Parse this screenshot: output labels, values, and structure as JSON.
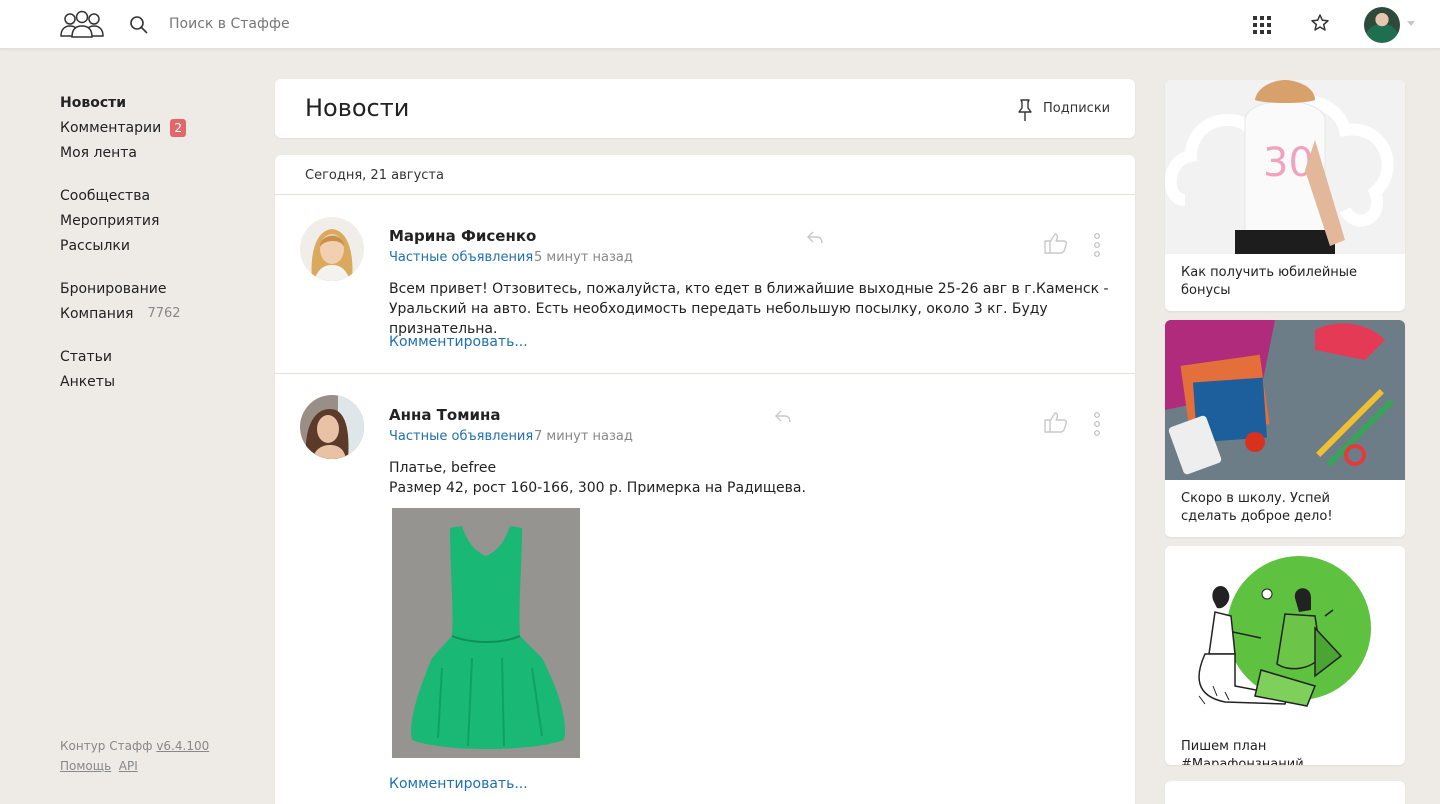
{
  "header": {
    "search_placeholder": "Поиск в Стаффе"
  },
  "nav": {
    "groups": [
      [
        {
          "label": "Новости",
          "active": true
        },
        {
          "label": "Комментарии",
          "badge": "2"
        },
        {
          "label": "Моя лента"
        }
      ],
      [
        {
          "label": "Сообщества"
        },
        {
          "label": "Мероприятия"
        },
        {
          "label": "Рассылки"
        }
      ],
      [
        {
          "label": "Бронирование"
        },
        {
          "label": "Компания",
          "count": "7762"
        }
      ],
      [
        {
          "label": "Статьи"
        },
        {
          "label": "Анкеты"
        }
      ]
    ]
  },
  "footer": {
    "product": "Контур Стафф",
    "version": "v6.4.100",
    "help": "Помощь",
    "api": "API"
  },
  "main": {
    "title": "Новости",
    "subscriptions_label": "Подписки",
    "date_header": "Сегодня, 21 августа",
    "posts": [
      {
        "author": "Марина Фисенко",
        "category": "Частные объявления",
        "time": "5 минут назад",
        "text": "Всем привет! Отзовитесь, пожалуйста, кто едет в ближайшие выходные 25-26 авг в г.Каменск - Уральский на авто. Есть необходимость передать небольшую посылку, около 3 кг. Буду признательна.",
        "comment_label": "Комментировать..."
      },
      {
        "author": "Анна Томина",
        "category": "Частные объявления",
        "time": "7 минут назад",
        "text_line1": "Платье, befree",
        "text_line2": "Размер 42, рост 160-166, 300 р. Примерка на Радищева.",
        "comment_label": "Комментировать..."
      }
    ]
  },
  "sidebar": {
    "promos": [
      {
        "caption": "Как получить юбилейные бонусы"
      },
      {
        "caption": "Скоро в школу. Успей сделать доброе дело!"
      },
      {
        "caption": "Пишем план #Марафонзнаний"
      }
    ]
  },
  "colors": {
    "accent_link": "#1f6fb2",
    "badge": "#e0676a",
    "background": "#eeebe6"
  }
}
